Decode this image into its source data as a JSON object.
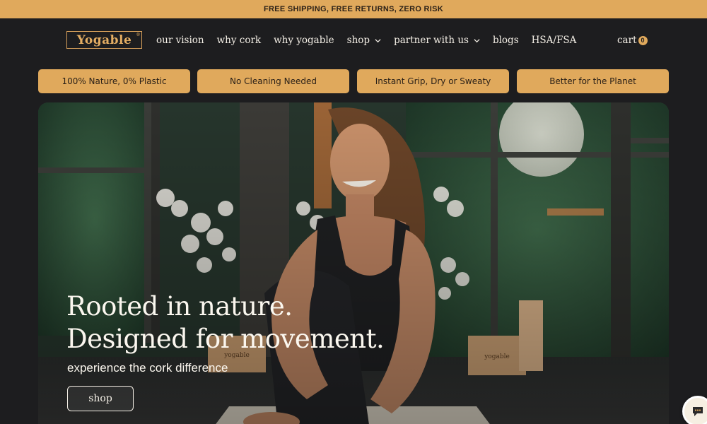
{
  "announcement": "FREE SHIPPING, FREE RETURNS, ZERO RISK",
  "brand": {
    "logo_text": "Yogable",
    "trademark": "®"
  },
  "nav": {
    "items": [
      {
        "label": "our vision",
        "has_dropdown": false
      },
      {
        "label": "why cork",
        "has_dropdown": false
      },
      {
        "label": "why yogable",
        "has_dropdown": false
      },
      {
        "label": "shop",
        "has_dropdown": true
      },
      {
        "label": "partner with us",
        "has_dropdown": true
      },
      {
        "label": "blogs",
        "has_dropdown": false
      },
      {
        "label": "HSA/FSA",
        "has_dropdown": false
      }
    ],
    "cart_label": "cart",
    "cart_count": "0"
  },
  "features": [
    "100% Nature, 0% Plastic",
    "No Cleaning Needed",
    "Instant Grip, Dry or Sweaty",
    "Better for the Planet"
  ],
  "hero": {
    "title_line1": "Rooted in nature.",
    "title_line2": "Designed for movement.",
    "subtitle": "experience the cork difference",
    "cta_label": "shop",
    "block_label": "yogable"
  },
  "colors": {
    "accent": "#e0a95c",
    "dark_bg": "#1d1d1f",
    "text_light": "#f4efe6"
  },
  "icons": {
    "dropdown": "chevron-down-icon",
    "chat": "chat-bubble-icon"
  }
}
